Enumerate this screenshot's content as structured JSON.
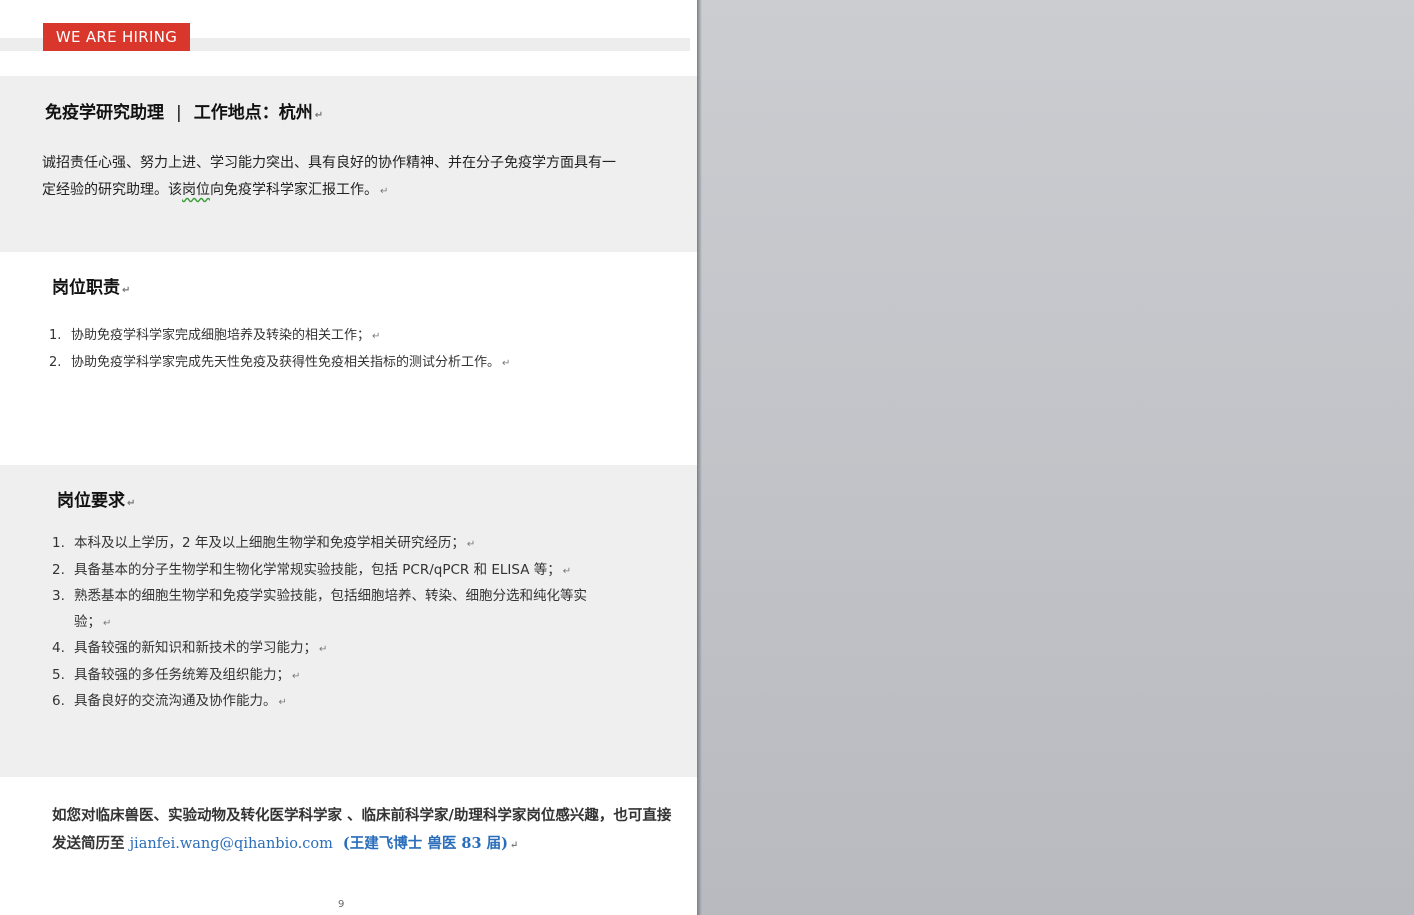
{
  "header": {
    "hiring_tag": "WE ARE HIRING"
  },
  "markers": {
    "paragraph": "↵",
    "corner": "↲"
  },
  "intro": {
    "position": "免疫学研究助理",
    "separator": "|",
    "location": "工作地点：杭州",
    "line1": "诚招责任心强、努力上进、学习能力突出、具有良好的协作精神、并在分子免疫学方面具有一",
    "line2_a": "定经验的研究助理。该",
    "line2_b": "岗位",
    "line2_c": "向免疫学科学家汇报工作。"
  },
  "duties": {
    "title": "岗位职责",
    "items": [
      {
        "num": "1.",
        "text": "协助免疫学科学家完成细胞培养及转染的相关工作；"
      },
      {
        "num": "2.",
        "text": "协助免疫学科学家完成先天性免疫及获得性免疫相关指标的测试分析工作。"
      }
    ]
  },
  "requirements": {
    "title": "岗位要求",
    "items": [
      {
        "num": "1.",
        "text": "本科及以上学历，2 年及以上细胞生物学和免疫学相关研究经历；"
      },
      {
        "num": "2.",
        "text": "具备基本的分子生物学和生物化学常规实验技能，包括 PCR/qPCR 和 ELISA 等；"
      },
      {
        "num": "3.",
        "text": "熟悉基本的细胞生物学和免疫学实验技能，包括细胞培养、转染、细胞分选和纯化等实验；"
      },
      {
        "num": "4.",
        "text": "具备较强的新知识和新技术的学习能力；"
      },
      {
        "num": "5.",
        "text": "具备较强的多任务统筹及组织能力；"
      },
      {
        "num": "6.",
        "text": "具备良好的交流沟通及协作能力。"
      }
    ]
  },
  "contact": {
    "line1": "如您对临床兽医、实验动物及转化医学科学家 、临床前科学家/助理科学家岗位感兴趣，也可直接",
    "prefix": "发送简历至",
    "email": "jianfei.wang@qihanbio.com",
    "signature": "(王建飞博士 兽医 83 届)"
  },
  "footer": {
    "page_number": "9"
  }
}
